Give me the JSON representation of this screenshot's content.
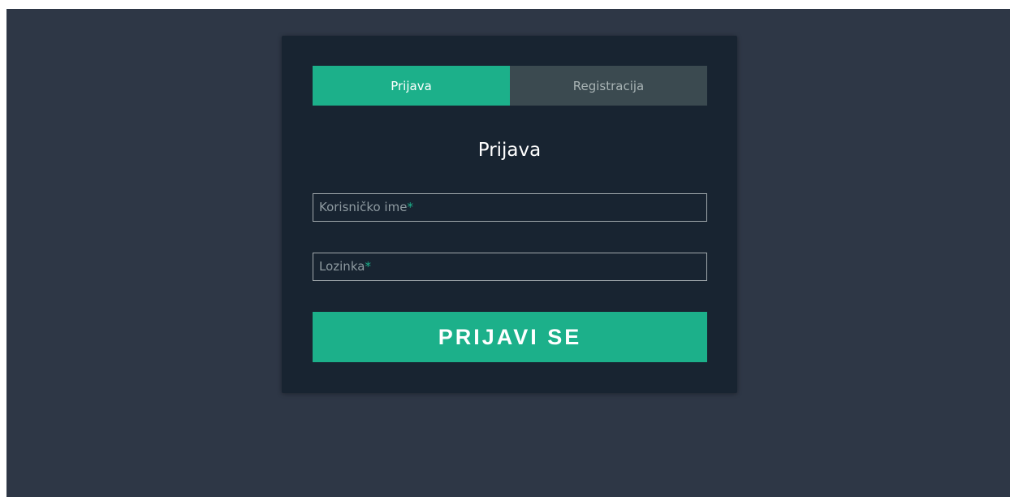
{
  "colors": {
    "page_background": "#2e3746",
    "card_background": "#182431",
    "accent": "#1cb08a",
    "inactive_tab": "#3b4a50"
  },
  "tabs": [
    {
      "label": "Prijava",
      "active": true
    },
    {
      "label": "Registracija",
      "active": false
    }
  ],
  "form": {
    "title": "Prijava",
    "username": {
      "label": "Korisničko ime",
      "required_mark": "*",
      "value": ""
    },
    "password": {
      "label": "Lozinka",
      "required_mark": "*",
      "value": ""
    },
    "submit_label": "PRIJAVI SE"
  }
}
